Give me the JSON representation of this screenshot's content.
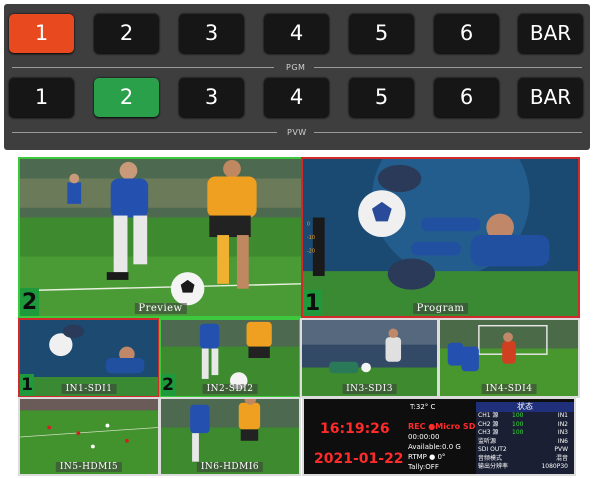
{
  "keyboard": {
    "pgm_row": [
      "1",
      "2",
      "3",
      "4",
      "5",
      "6",
      "BAR"
    ],
    "pvw_row": [
      "1",
      "2",
      "3",
      "4",
      "5",
      "6",
      "BAR"
    ],
    "pgm_label": "PGM",
    "pvw_label": "PVW",
    "colors": {
      "pgm_active": "#e8491f",
      "pvw_active": "#2aa04a",
      "key": "#161616"
    }
  },
  "multiview": {
    "preview": {
      "label": "Preview",
      "badge": "2"
    },
    "program": {
      "label": "Program",
      "badge": "1"
    },
    "inputs": [
      {
        "label": "IN1-SDI1",
        "badge": "1"
      },
      {
        "label": "IN2-SDI2",
        "badge": "2"
      },
      {
        "label": "IN3-SDI3",
        "badge": ""
      },
      {
        "label": "IN4-SDI4",
        "badge": ""
      },
      {
        "label": "IN5-HDMI5",
        "badge": ""
      },
      {
        "label": "IN6-HDMI6",
        "badge": ""
      }
    ],
    "status": {
      "time": "16:19:26",
      "date": "2021-01-22",
      "temp": "T:32° C",
      "rec": "REC ●Micro SD",
      "rec_timer": "00:00:00",
      "available": "Available:0.0  G",
      "rtmp": "RTMP  ●     0°",
      "tally": "Tally:OFF",
      "table_title": "状态",
      "table_rows": [
        [
          "CH1 源",
          "100",
          "IN1"
        ],
        [
          "CH2 源",
          "100",
          "IN2"
        ],
        [
          "CH3 源",
          "100",
          "IN3"
        ],
        [
          "监听源",
          "",
          "IN6"
        ],
        [
          "SDI OUT2",
          "",
          "PVW"
        ],
        [
          "音频模式",
          "",
          "混音"
        ],
        [
          "输出分辨率",
          "",
          "1080P30"
        ]
      ]
    }
  }
}
